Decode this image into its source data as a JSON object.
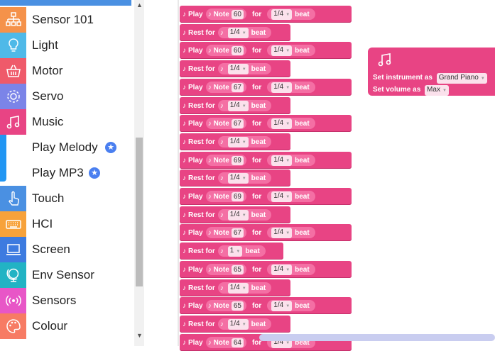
{
  "sidebar": {
    "categories": [
      {
        "label": "Sensor 101",
        "icon": "hierarchy-icon",
        "color": "#f5924a"
      },
      {
        "label": "Light",
        "icon": "lightbulb-icon",
        "color": "#4fb9e8"
      },
      {
        "label": "Motor",
        "icon": "basket-icon",
        "color": "#ef5a6a"
      },
      {
        "label": "Servo",
        "icon": "gear-icon",
        "color": "#7b84e8"
      },
      {
        "label": "Music",
        "icon": "music-note-icon",
        "color": "#e84484"
      },
      {
        "label": "Play Melody",
        "icon": "",
        "color": ""
      },
      {
        "label": "Play MP3",
        "icon": "",
        "color": ""
      },
      {
        "label": "Touch",
        "icon": "hand-pointer-icon",
        "color": "#4a90e2"
      },
      {
        "label": "HCI",
        "icon": "keyboard-icon",
        "color": "#f7a23b"
      },
      {
        "label": "Screen",
        "icon": "laptop-icon",
        "color": "#3d7be0"
      },
      {
        "label": "Env Sensor",
        "icon": "globe-icon",
        "color": "#22b3c4"
      },
      {
        "label": "Sensors",
        "icon": "signal-icon",
        "color": "#e856c7"
      },
      {
        "label": "Colour",
        "icon": "palette-icon",
        "color": "#f77b64"
      }
    ],
    "badge_glyph": "★"
  },
  "blocks": [
    {
      "type": "play",
      "note": "60",
      "beat": "1/4"
    },
    {
      "type": "rest",
      "beat": "1/4"
    },
    {
      "type": "play",
      "note": "60",
      "beat": "1/4"
    },
    {
      "type": "rest",
      "beat": "1/4"
    },
    {
      "type": "play",
      "note": "67",
      "beat": "1/4"
    },
    {
      "type": "rest",
      "beat": "1/4"
    },
    {
      "type": "play",
      "note": "67",
      "beat": "1/4"
    },
    {
      "type": "rest",
      "beat": "1/4"
    },
    {
      "type": "play",
      "note": "69",
      "beat": "1/4"
    },
    {
      "type": "rest",
      "beat": "1/4"
    },
    {
      "type": "play",
      "note": "69",
      "beat": "1/4"
    },
    {
      "type": "rest",
      "beat": "1/4"
    },
    {
      "type": "play",
      "note": "67",
      "beat": "1/4"
    },
    {
      "type": "rest",
      "beat": "1"
    },
    {
      "type": "play",
      "note": "65",
      "beat": "1/4"
    },
    {
      "type": "rest",
      "beat": "1/4"
    },
    {
      "type": "play",
      "note": "65",
      "beat": "1/4"
    },
    {
      "type": "rest",
      "beat": "1/4"
    },
    {
      "type": "play",
      "note": "64",
      "beat": "1/4"
    }
  ],
  "block_words": {
    "play": "Play",
    "note": "Note",
    "for": "for",
    "beat": "beat",
    "rest_for": "Rest for",
    "glyph": "♪"
  },
  "instrument_block": {
    "instrument_label": "Set instrument as",
    "instrument_value": "Grand Piano",
    "volume_label": "Set volume as",
    "volume_value": "Max"
  },
  "colors": {
    "block": "#e84484",
    "accent": "#2196f3"
  }
}
